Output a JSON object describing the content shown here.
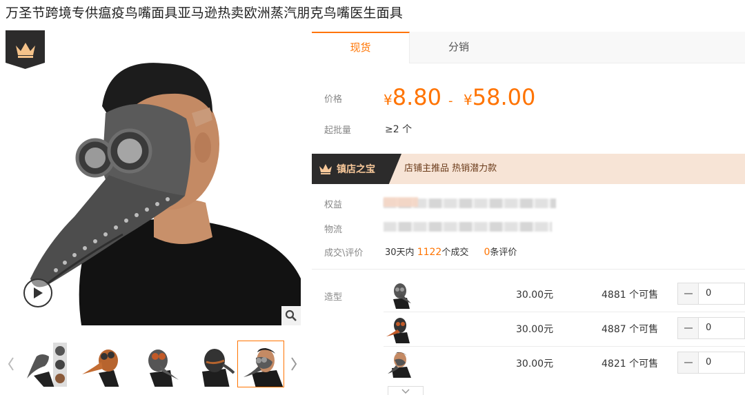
{
  "product": {
    "title": "万圣节跨境专供瘟疫鸟嘴面具亚马逊热卖欧洲蒸汽朋克鸟嘴医生面具"
  },
  "gallery": {
    "thumb_count": 5,
    "active_thumb": 5
  },
  "tabs": [
    {
      "label": "现货",
      "active": true
    },
    {
      "label": "分销",
      "active": false
    }
  ],
  "pricing": {
    "price_label": "价格",
    "currency": "¥",
    "price_min": "8.80",
    "price_sep": "-",
    "price_max": "58.00",
    "moq_label": "起批量",
    "moq_value": "≥2 个"
  },
  "treasure": {
    "badge": "镇店之宝",
    "text": "店铺主推品   热销潜力款"
  },
  "info": {
    "rights_label": "权益",
    "logistics_label": "物流",
    "deal_label": "成交\\评价",
    "deal_prefix": "30天内",
    "deal_count": "1122",
    "deal_suffix": "个成交",
    "review_count": "0",
    "review_suffix": "条评价"
  },
  "variants": {
    "label": "造型",
    "items": [
      {
        "price": "30.00元",
        "stock": "4881 个可售",
        "qty": "0"
      },
      {
        "price": "30.00元",
        "stock": "4887 个可售",
        "qty": "0"
      },
      {
        "price": "30.00元",
        "stock": "4821 个可售",
        "qty": "0"
      }
    ]
  },
  "colors": {
    "accent": "#ff7300",
    "dark_badge": "#2c2b2b",
    "treasure_bg": "#f7e4d6"
  }
}
